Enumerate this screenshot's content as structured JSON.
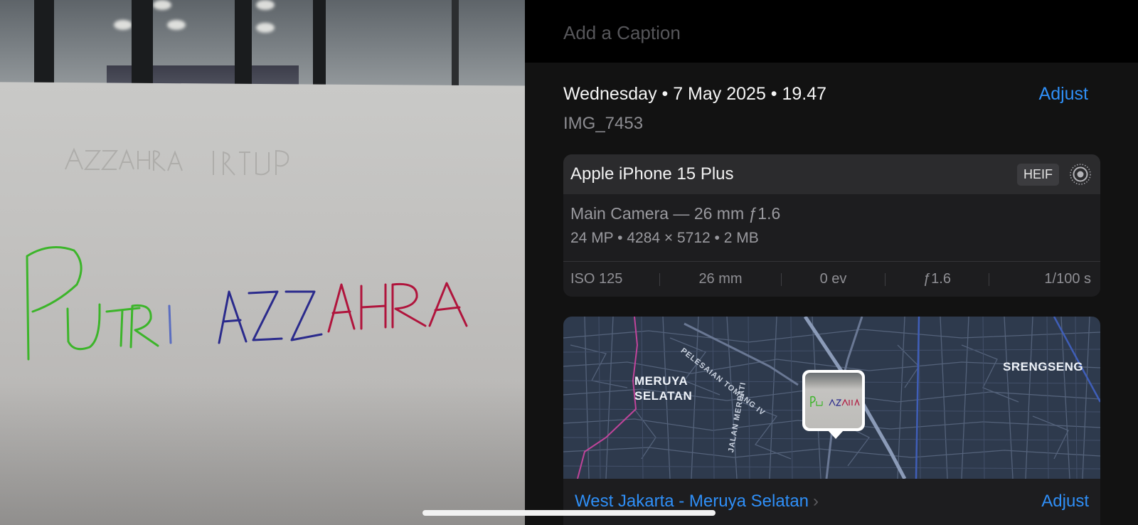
{
  "photo": {
    "handwriting": {
      "part1": "PUTRI",
      "part2a": "AZZ",
      "part2b": "AHRA"
    },
    "bleed_through": "AZZAHRA  PUTRI",
    "colors": {
      "green": "#3cb52a",
      "blue": "#2a2a8c",
      "red": "#b0143c"
    }
  },
  "caption": {
    "placeholder": "Add a Caption"
  },
  "info": {
    "date": "Wednesday • 7 May 2025 • 19.47",
    "adjust_label": "Adjust",
    "filename": "IMG_7453"
  },
  "device": {
    "name": "Apple iPhone 15 Plus",
    "format_badge": "HEIF",
    "live_icon": "live-photo-icon",
    "camera": "Main Camera — 26 mm ƒ1.6",
    "specs": "24 MP • 4284 × 5712 • 2 MB",
    "exif": {
      "iso": "ISO 125",
      "focal": "26 mm",
      "ev": "0 ev",
      "aperture": "ƒ1.6",
      "shutter": "1/100 s"
    }
  },
  "map": {
    "labels": {
      "meruya_line1": "MERUYA",
      "meruya_line2": "SELATAN",
      "srengseng": "SRENGSENG",
      "street1": "PELESAIAN TOMANG IV",
      "street2": "JALAN MERPATI"
    },
    "location": "West Jakarta - Meruya Selatan",
    "adjust_label": "Adjust"
  },
  "colors": {
    "accent": "#2f8ff7",
    "panel_bg": "#121212",
    "card_bg": "#1d1d1f"
  }
}
